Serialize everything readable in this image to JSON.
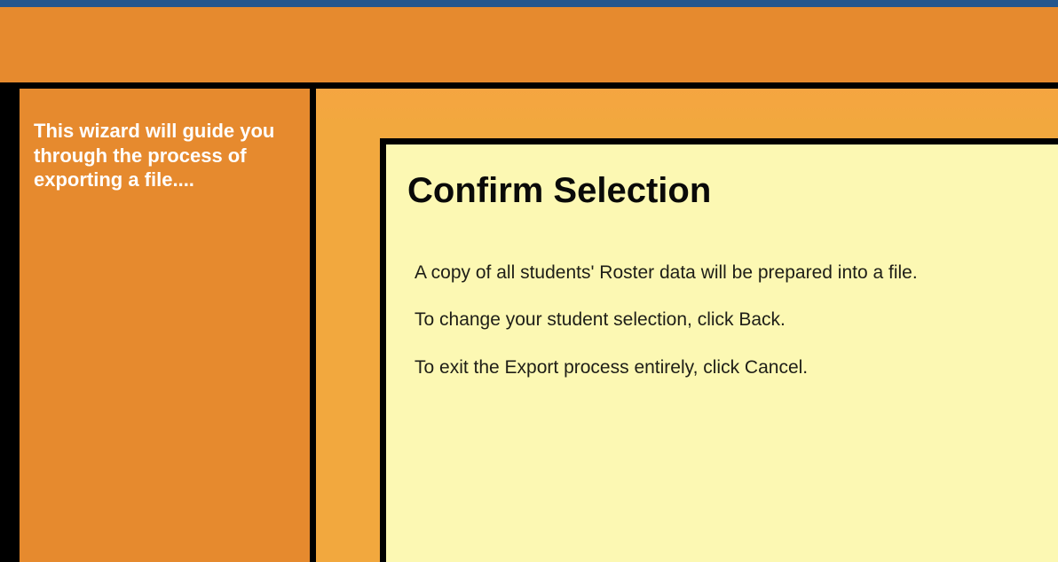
{
  "sidebar": {
    "description": "This wizard will guide you through the process of exporting a file...."
  },
  "panel": {
    "heading": "Confirm Selection",
    "line1": "A copy of all students' Roster data will be prepared into a file.",
    "line2": "To change your student selection, click Back.",
    "line3": "To exit the Export process entirely, click Cancel."
  }
}
